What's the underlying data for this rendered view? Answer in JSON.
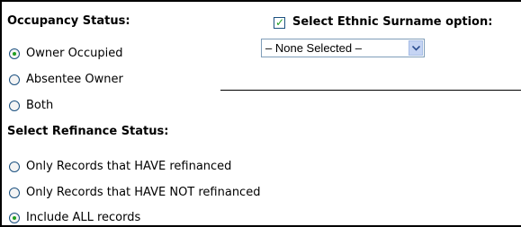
{
  "occupancy": {
    "heading": "Occupancy Status:",
    "options": [
      {
        "label": "Owner Occupied",
        "checked": true
      },
      {
        "label": "Absentee Owner",
        "checked": false
      },
      {
        "label": "Both",
        "checked": false
      }
    ]
  },
  "ethnic": {
    "checkbox_label": "Select Ethnic Surname option:",
    "checkbox_checked": true,
    "select_value": "– None Selected –"
  },
  "refinance": {
    "heading": "Select Refinance Status:",
    "options": [
      {
        "label": "Only Records that HAVE refinanced",
        "checked": false
      },
      {
        "label": "Only Records that HAVE NOT refinanced",
        "checked": false
      },
      {
        "label": "Include ALL records",
        "checked": true
      }
    ]
  },
  "colors": {
    "accent_check": "#1e9e1e",
    "control_border": "#1c5180",
    "select_arrow_bg": "#c5d4f3"
  },
  "icons": {
    "checkbox_check": "check-icon",
    "select_arrow": "chevron-down-icon"
  }
}
